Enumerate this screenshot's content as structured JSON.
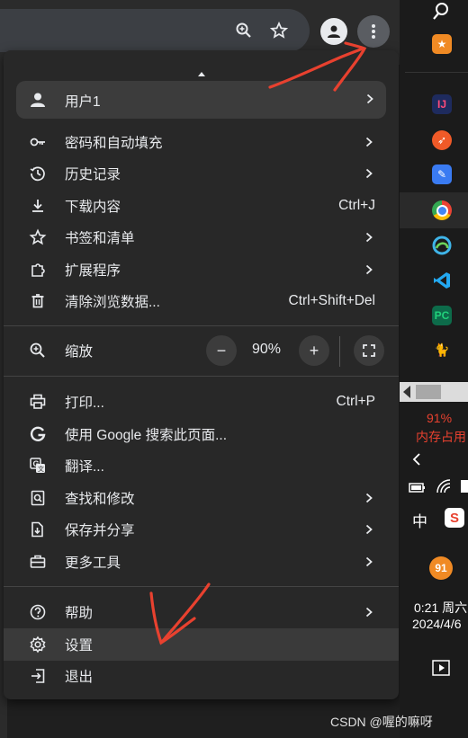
{
  "browser": {
    "toolbar_icons": [
      "zoom-icon",
      "bookmark-star-icon",
      "profile-avatar-icon",
      "more-vert-icon"
    ]
  },
  "menu": {
    "profile_label": "用户1",
    "items_group1": [
      {
        "label": "密码和自动填充",
        "icon": "key-icon",
        "submenu": true
      },
      {
        "label": "历史记录",
        "icon": "history-icon",
        "submenu": true
      },
      {
        "label": "下载内容",
        "icon": "download-icon",
        "shortcut": "Ctrl+J"
      },
      {
        "label": "书签和清单",
        "icon": "star-icon",
        "submenu": true
      },
      {
        "label": "扩展程序",
        "icon": "puzzle-icon",
        "submenu": true
      },
      {
        "label": "清除浏览数据...",
        "icon": "trash-icon",
        "shortcut": "Ctrl+Shift+Del"
      }
    ],
    "zoom": {
      "label": "缩放",
      "minus": "−",
      "value": "90%",
      "plus": "+"
    },
    "items_group2": [
      {
        "label": "打印...",
        "icon": "print-icon",
        "shortcut": "Ctrl+P"
      },
      {
        "label": "使用 Google 搜索此页面...",
        "icon": "google-g-icon"
      },
      {
        "label": "翻译...",
        "icon": "translate-icon"
      },
      {
        "label": "查找和修改",
        "icon": "find-icon",
        "submenu": true
      },
      {
        "label": "保存并分享",
        "icon": "save-share-icon",
        "submenu": true
      },
      {
        "label": "更多工具",
        "icon": "toolbox-icon",
        "submenu": true
      }
    ],
    "items_group3": [
      {
        "label": "帮助",
        "icon": "help-icon",
        "submenu": true
      },
      {
        "label": "设置",
        "icon": "gear-icon",
        "highlighted": true
      },
      {
        "label": "退出",
        "icon": "exit-icon"
      }
    ]
  },
  "taskbar": {
    "memory_percent": "91%",
    "memory_label": "内存占用",
    "ime": "中",
    "notification_count": "91",
    "time": "0:21 周六",
    "date": "2024/4/6"
  },
  "watermark": "CSDN @喔的嘛呀",
  "colors": {
    "accent_red": "#e8412f",
    "menu_bg": "#282828",
    "highlight": "#3a3a3a"
  }
}
